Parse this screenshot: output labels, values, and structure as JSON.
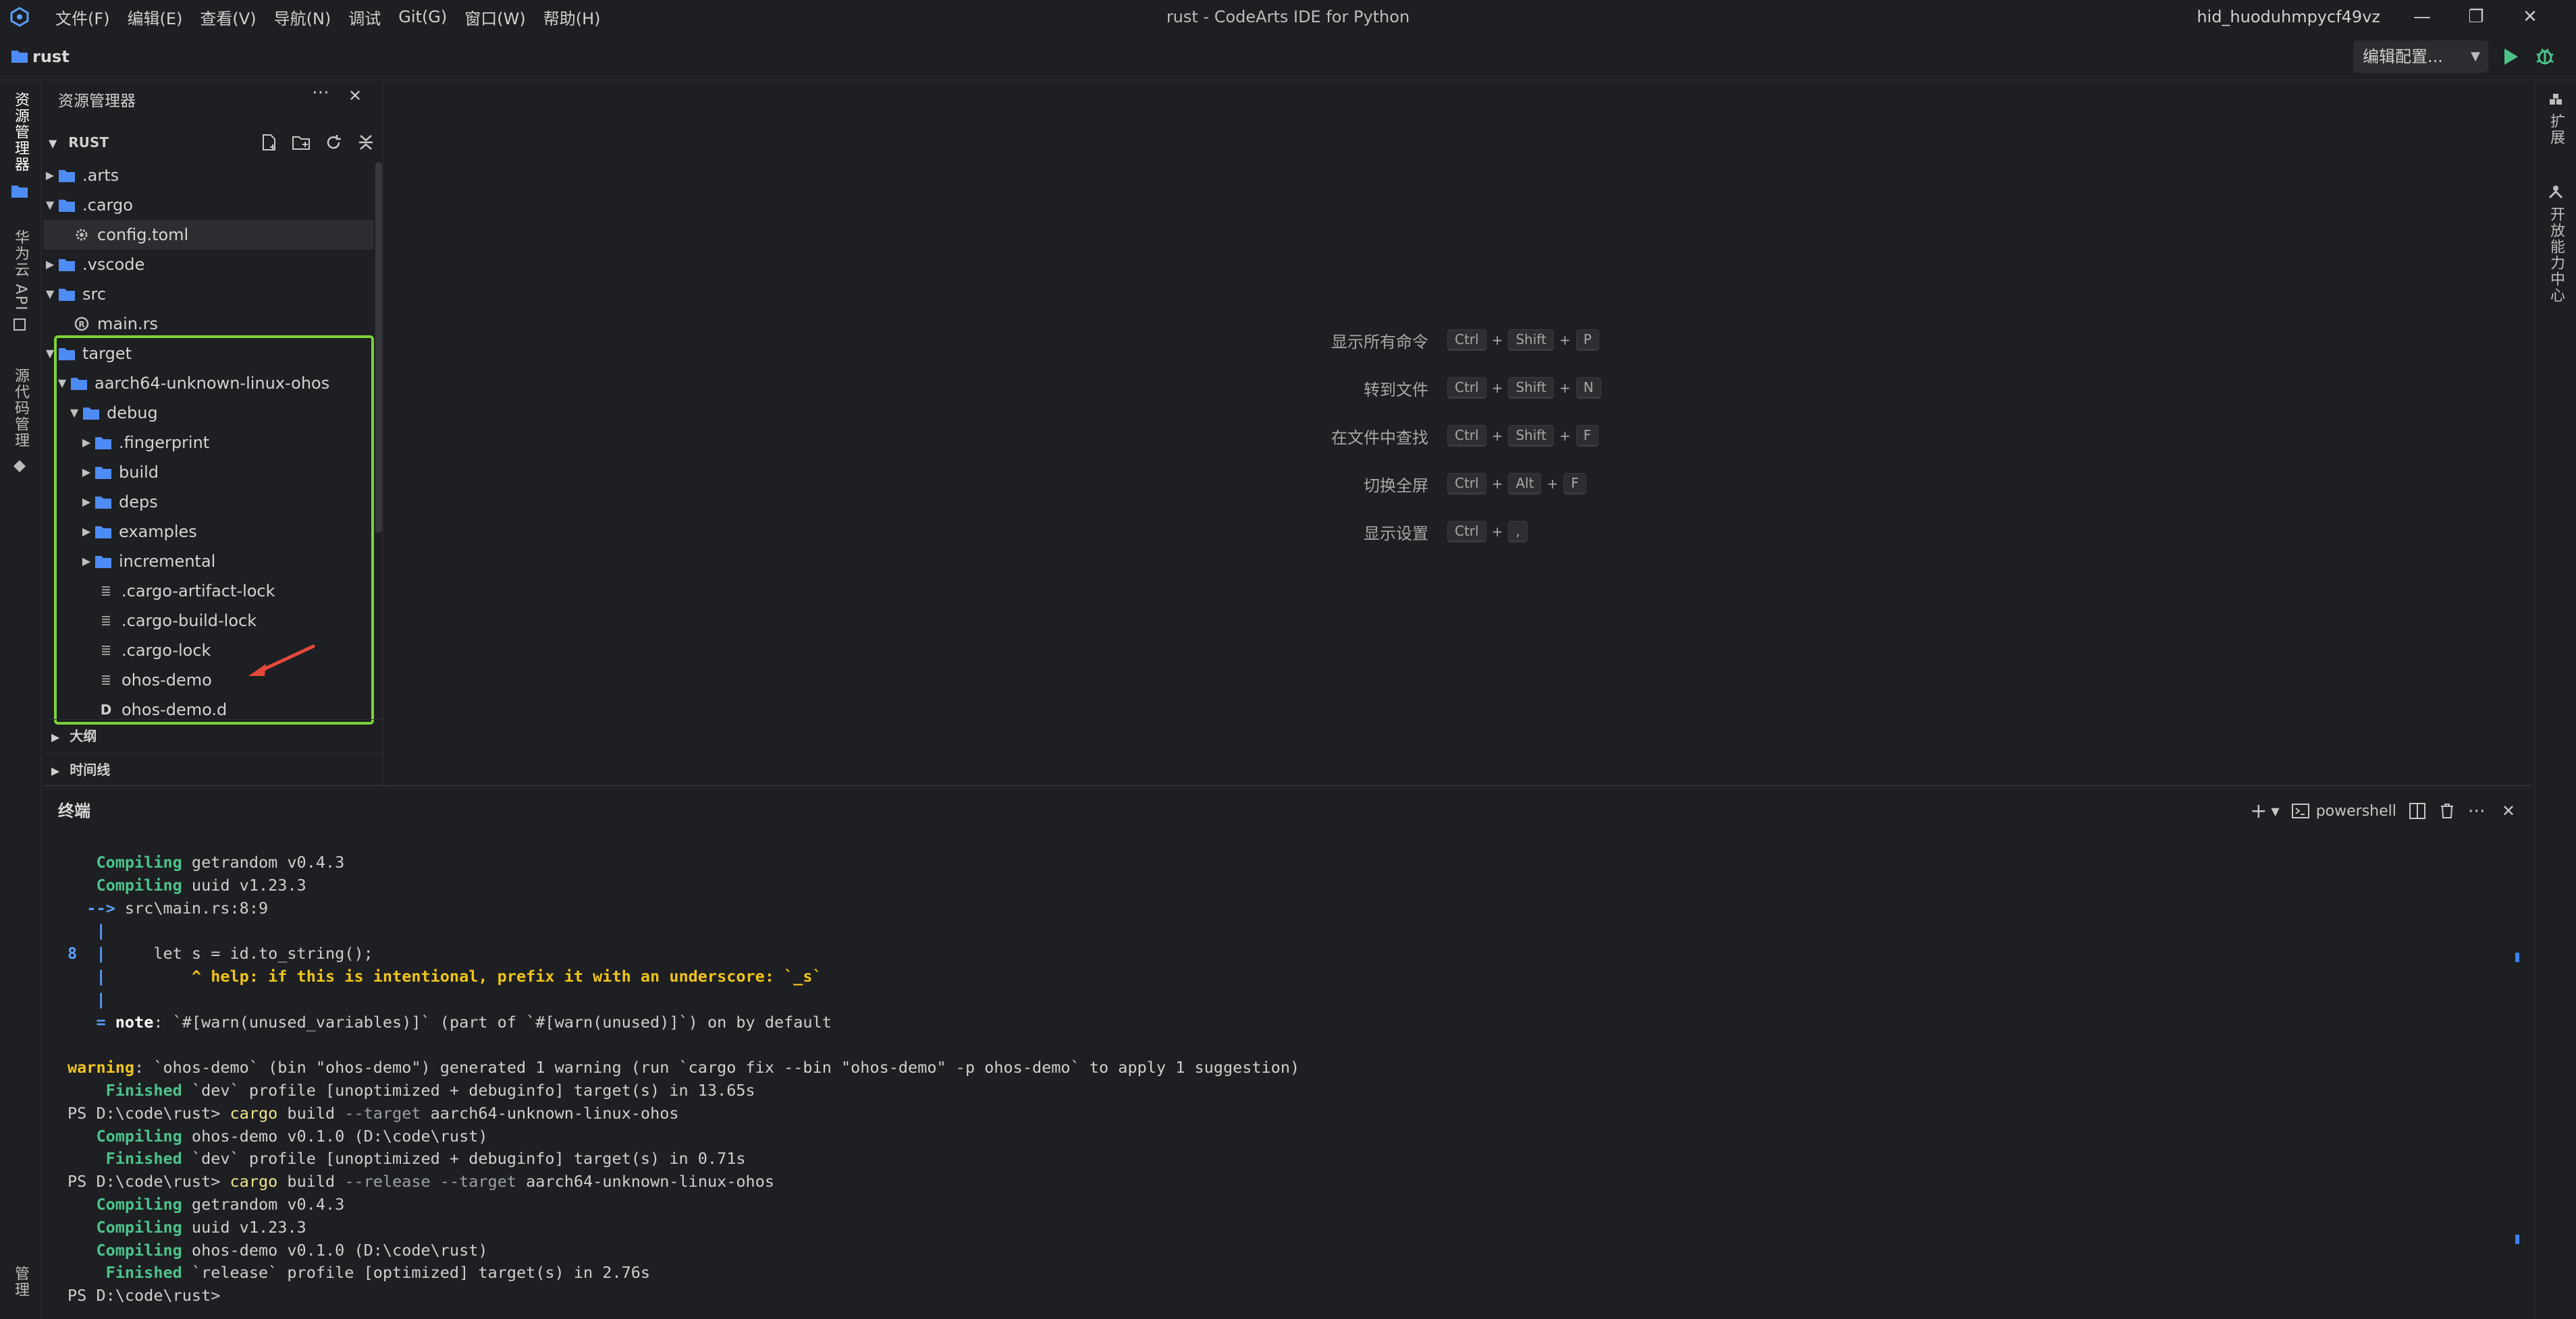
{
  "titlebar": {
    "menu": [
      "文件(F)",
      "编辑(E)",
      "查看(V)",
      "导航(N)",
      "调试",
      "Git(G)",
      "窗口(W)",
      "帮助(H)"
    ],
    "window_title": "rust - CodeArts IDE for Python",
    "user": "hid_huoduhmpycf49vz"
  },
  "projectbar": {
    "project": "rust",
    "run_config": "编辑配置..."
  },
  "leftbar": {
    "items": [
      "资源管理器",
      "华为云 API",
      "源代码管理"
    ],
    "bottom": "管理"
  },
  "rightbar": {
    "items": [
      "扩展",
      "开放能力中心"
    ]
  },
  "explorer": {
    "title": "资源管理器",
    "root": "RUST",
    "tree": [
      {
        "label": ".arts",
        "type": "folder",
        "depth": 0,
        "expanded": false
      },
      {
        "label": ".cargo",
        "type": "folder",
        "depth": 0,
        "expanded": true
      },
      {
        "label": "config.toml",
        "type": "gear-file",
        "depth": 1,
        "selected": true
      },
      {
        "label": ".vscode",
        "type": "folder",
        "depth": 0,
        "expanded": false
      },
      {
        "label": "src",
        "type": "folder",
        "depth": 0,
        "expanded": true
      },
      {
        "label": "main.rs",
        "type": "rust-file",
        "depth": 1
      },
      {
        "label": "target",
        "type": "folder",
        "depth": 0,
        "expanded": true
      },
      {
        "label": "aarch64-unknown-linux-ohos",
        "type": "folder",
        "depth": 1,
        "expanded": true
      },
      {
        "label": "debug",
        "type": "folder",
        "depth": 2,
        "expanded": true
      },
      {
        "label": ".fingerprint",
        "type": "folder",
        "depth": 3,
        "expanded": false
      },
      {
        "label": "build",
        "type": "folder",
        "depth": 3,
        "expanded": false
      },
      {
        "label": "deps",
        "type": "folder",
        "depth": 3,
        "expanded": false
      },
      {
        "label": "examples",
        "type": "folder",
        "depth": 3,
        "expanded": false
      },
      {
        "label": "incremental",
        "type": "folder",
        "depth": 3,
        "expanded": false
      },
      {
        "label": ".cargo-artifact-lock",
        "type": "text-file",
        "depth": 3
      },
      {
        "label": ".cargo-build-lock",
        "type": "text-file",
        "depth": 3
      },
      {
        "label": ".cargo-lock",
        "type": "text-file",
        "depth": 3
      },
      {
        "label": "ohos-demo",
        "type": "text-file",
        "depth": 3
      },
      {
        "label": "ohos-demo.d",
        "type": "d-file",
        "depth": 3
      }
    ],
    "sections": [
      "大纲",
      "时间线"
    ]
  },
  "shortcuts": [
    {
      "label": "显示所有命令",
      "keys": [
        "Ctrl",
        "Shift",
        "P"
      ]
    },
    {
      "label": "转到文件",
      "keys": [
        "Ctrl",
        "Shift",
        "N"
      ]
    },
    {
      "label": "在文件中查找",
      "keys": [
        "Ctrl",
        "Shift",
        "F"
      ]
    },
    {
      "label": "切换全屏",
      "keys": [
        "Ctrl",
        "Alt",
        "F"
      ]
    },
    {
      "label": "显示设置",
      "keys": [
        "Ctrl",
        ","
      ]
    }
  ],
  "terminal": {
    "title": "终端",
    "shell": "powershell",
    "lines": [
      [
        {
          "t": "   Compiling",
          "c": "g"
        },
        {
          "t": " getrandom v0.4.3"
        }
      ],
      [
        {
          "t": "   Compiling",
          "c": "g"
        },
        {
          "t": " uuid v1.23.3"
        }
      ],
      [
        {
          "t": "  -->",
          "c": "b"
        },
        {
          "t": " src\\main.rs:8:9"
        }
      ],
      [
        {
          "t": "   |",
          "c": "b"
        }
      ],
      [
        {
          "t": "8  |",
          "c": "b"
        },
        {
          "t": "     let s = id.to_string();"
        }
      ],
      [
        {
          "t": "   |",
          "c": "b"
        },
        {
          "t": "         ^ help: if this is intentional, prefix it with an underscore: `_s`",
          "c": "y"
        }
      ],
      [
        {
          "t": "   |",
          "c": "b"
        }
      ],
      [
        {
          "t": "   = ",
          "c": "b"
        },
        {
          "t": "note",
          "c": "w"
        },
        {
          "t": ": `#[warn(unused_variables)]` (part of `#[warn(unused)]`) on by default"
        }
      ],
      [
        {
          "t": ""
        }
      ],
      [
        {
          "t": "warning",
          "c": "y"
        },
        {
          "t": ": `ohos-demo` (bin \"ohos-demo\") generated 1 warning (run `cargo fix --bin \"ohos-demo\" -p ohos-demo` to apply 1 suggestion)"
        }
      ],
      [
        {
          "t": "    Finished",
          "c": "g"
        },
        {
          "t": " `dev` profile [unoptimized + debuginfo] target(s) in 13.65s"
        }
      ],
      [
        {
          "t": "PS D:\\code\\rust> "
        },
        {
          "t": "cargo",
          "c": "cmd"
        },
        {
          "t": " build "
        },
        {
          "t": "--target",
          "c": "dim"
        },
        {
          "t": " aarch64-unknown-linux-ohos"
        }
      ],
      [
        {
          "t": "   Compiling",
          "c": "g"
        },
        {
          "t": " ohos-demo v0.1.0 (D:\\code\\rust)"
        }
      ],
      [
        {
          "t": "    Finished",
          "c": "g"
        },
        {
          "t": " `dev` profile [unoptimized + debuginfo] target(s) in 0.71s"
        }
      ],
      [
        {
          "t": "PS D:\\code\\rust> "
        },
        {
          "t": "cargo",
          "c": "cmd"
        },
        {
          "t": " build "
        },
        {
          "t": "--release --target",
          "c": "dim"
        },
        {
          "t": " aarch64-unknown-linux-ohos"
        }
      ],
      [
        {
          "t": "   Compiling",
          "c": "g"
        },
        {
          "t": " getrandom v0.4.3"
        }
      ],
      [
        {
          "t": "   Compiling",
          "c": "g"
        },
        {
          "t": " uuid v1.23.3"
        }
      ],
      [
        {
          "t": "   Compiling",
          "c": "g"
        },
        {
          "t": " ohos-demo v0.1.0 (D:\\code\\rust)"
        }
      ],
      [
        {
          "t": "    Finished",
          "c": "g"
        },
        {
          "t": " `release` profile [optimized] target(s) in 2.76s"
        }
      ],
      [
        {
          "t": "PS D:\\code\\rust>"
        }
      ]
    ]
  },
  "colors": {
    "background": "#1e1f22",
    "highlight_box": "#7dd33a",
    "arrow": "#e5483b",
    "folder": "#4e8cf5",
    "run": "#4cc38a"
  }
}
